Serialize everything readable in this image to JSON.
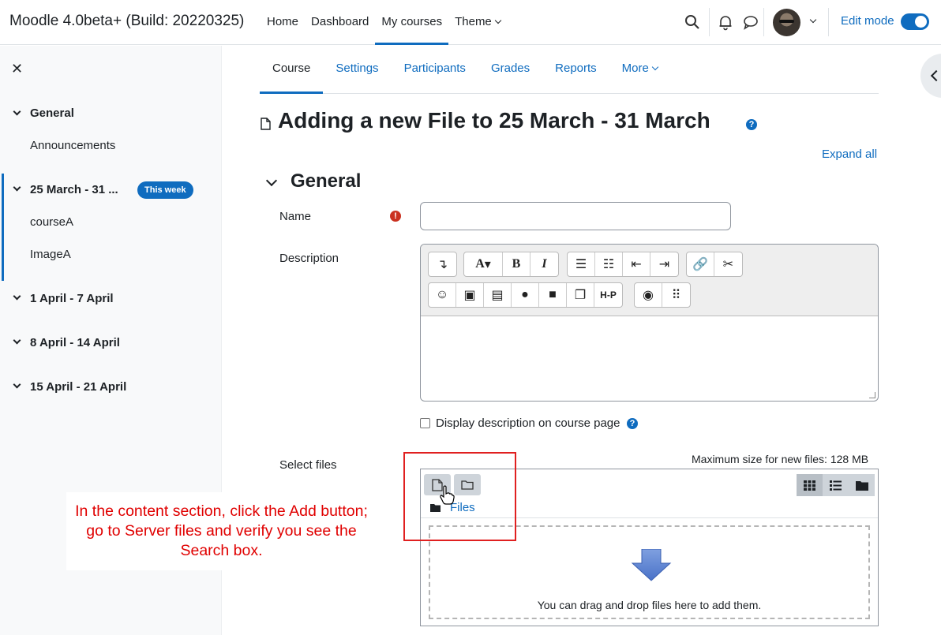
{
  "brand": "Moodle 4.0beta+ (Build: 20220325)",
  "primary_nav": [
    "Home",
    "Dashboard",
    "My courses",
    "Theme"
  ],
  "edit_mode_label": "Edit mode",
  "sidebar": {
    "sections": [
      {
        "title": "General",
        "items": [
          "Announcements"
        ]
      },
      {
        "title": "25 March - 31 ...",
        "badge": "This week",
        "items": [
          "courseA",
          "ImageA"
        ]
      },
      {
        "title": "1 April - 7 April",
        "items": []
      },
      {
        "title": "8 April - 14 April",
        "items": []
      },
      {
        "title": "15 April - 21 April",
        "items": []
      }
    ]
  },
  "secondary_nav": [
    "Course",
    "Settings",
    "Participants",
    "Grades",
    "Reports",
    "More"
  ],
  "page_title": "Adding a new File to 25 March - 31 March",
  "expand_all": "Expand all",
  "general_heading": "General",
  "form": {
    "name_label": "Name",
    "name_value": "",
    "description_label": "Description",
    "display_description_label": "Display description on course page",
    "select_files_label": "Select files",
    "max_size": "Maximum size for new files: 128 MB",
    "files_path": "Files",
    "dropzone_text": "You can drag and drop files here to add them."
  },
  "annotation": {
    "text": "In the content section, click the Add button; go to Server files and verify you see the Search box.",
    "color": "#e00000"
  },
  "colors": {
    "accent": "#0f6cbf",
    "required": "#ca3120"
  }
}
